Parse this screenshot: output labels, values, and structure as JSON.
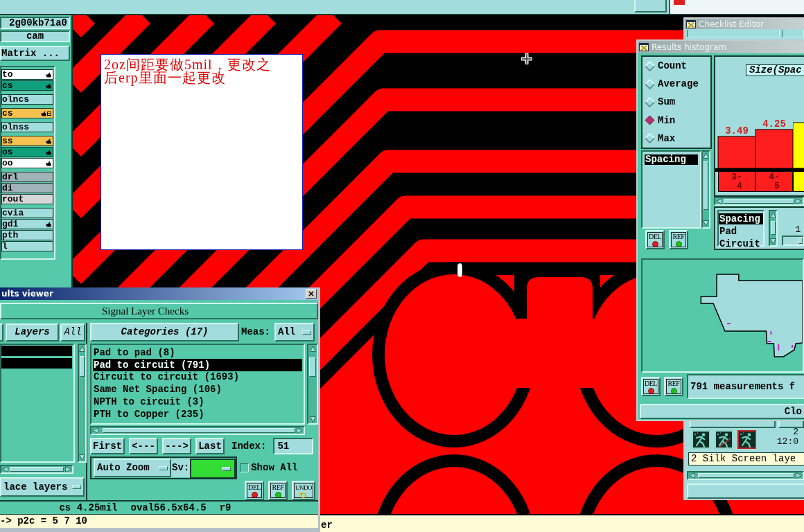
{
  "job": {
    "name": "2g00kb71a0",
    "step": "cam",
    "matrix_button": "Matrix ..."
  },
  "layer_groups": [
    {
      "layers": [
        {
          "name": "to",
          "color": "#ffffff",
          "affected": true,
          "work": false
        },
        {
          "name": "cs",
          "color": "#0f9f7d",
          "affected": true,
          "work": false
        }
      ]
    },
    {
      "layers": [
        {
          "name": "olncs",
          "color": "#a3dede",
          "affected": false,
          "work": false
        }
      ]
    },
    {
      "layers": [
        {
          "name": "cs",
          "color": "#f7c151",
          "affected": true,
          "work": true
        }
      ]
    },
    {
      "layers": [
        {
          "name": "olnss",
          "color": "#a3dede",
          "affected": false,
          "work": false
        }
      ]
    },
    {
      "layers": [
        {
          "name": "ss",
          "color": "#f7c151",
          "affected": true,
          "work": false
        },
        {
          "name": "os",
          "color": "#0f9f7d",
          "affected": true,
          "work": false
        },
        {
          "name": "oo",
          "color": "#ffffff",
          "affected": true,
          "work": false
        }
      ]
    },
    {
      "layers": [
        {
          "name": "drl",
          "color": "#9fb3b8",
          "affected": false,
          "work": false
        },
        {
          "name": "di",
          "color": "#9fb3b8",
          "affected": false,
          "work": false
        },
        {
          "name": "rout",
          "color": "#d6d6d6",
          "affected": false,
          "work": false
        }
      ]
    },
    {
      "layers": [
        {
          "name": "cvia",
          "color": "#a3dede",
          "affected": false,
          "work": false
        },
        {
          "name": "gd1",
          "color": "#a3dede",
          "affected": true,
          "work": false
        },
        {
          "name": "pth",
          "color": "#a3dede",
          "affected": false,
          "work": false
        },
        {
          "name": "l",
          "color": "#a3dede",
          "affected": false,
          "work": false
        }
      ]
    }
  ],
  "canvas": {
    "note": "2oz间距要做5mil，更改之后erp里面一起更改"
  },
  "results_viewer": {
    "title": "ults viewer",
    "header": "Signal Layer Checks",
    "layers_button": "Layers",
    "all_button": "All",
    "layer_rows": [
      {
        "selected": true
      },
      {
        "selected": true
      }
    ],
    "layer_scope": "lace layers",
    "categories_button": "Categories (17)",
    "meas_label": "Meas:",
    "meas_value": "All",
    "categories": [
      {
        "label": "Pad to pad (8)",
        "selected": false
      },
      {
        "label": "Pad to circuit (791)",
        "selected": true
      },
      {
        "label": "Circuit to circuit (1693)",
        "selected": false
      },
      {
        "label": "Same Net Spacing (106)",
        "selected": false
      },
      {
        "label": "NPTH to circuit (3)",
        "selected": false
      },
      {
        "label": "PTH to Copper (235)",
        "selected": false
      }
    ],
    "nav_buttons": [
      "First",
      "<---",
      "--->",
      "Last"
    ],
    "index_label": "Index:",
    "index_value": "51",
    "zoom_mode": "Auto Zoom",
    "sv_label": "Sv:",
    "show_all": {
      "label": "Show All",
      "checked": false
    },
    "tool_buttons": [
      {
        "kind": "delete",
        "label": "DEL"
      },
      {
        "kind": "refresh",
        "label": "REF"
      },
      {
        "kind": "undo",
        "label": "UNDO"
      }
    ],
    "measure_info": [
      "cs 4.25mil",
      "oval56.5x64.5",
      "r9"
    ],
    "command_line": "-> p2c = 5 7 10"
  },
  "histogram": {
    "title": "Results histogram",
    "modes": [
      {
        "label": "Count",
        "selected": false
      },
      {
        "label": "Average",
        "selected": false
      },
      {
        "label": "Sum",
        "selected": false
      },
      {
        "label": "Min",
        "selected": true
      },
      {
        "label": "Max",
        "selected": false
      }
    ],
    "types": [
      {
        "label": "Spacing",
        "selected": true
      }
    ],
    "list_buttons": [
      {
        "kind": "delete",
        "label": "DEL"
      },
      {
        "kind": "refresh",
        "label": "REF"
      }
    ],
    "chart_data": {
      "type": "bar",
      "title": "Size(Spac",
      "categories": [
        "3-4",
        "4-5"
      ],
      "series": [
        {
          "color": "#ff1e1e",
          "values": [
            3.49,
            4.25
          ]
        }
      ],
      "data_labels": true
    },
    "clipped_bar": {
      "color": "#ffff00"
    },
    "filters": [
      {
        "label": "Spacing",
        "selected": true
      },
      {
        "label": "Pad",
        "selected": false
      },
      {
        "label": "Circuit",
        "selected": false
      }
    ],
    "range_value": "1",
    "overview_buttons": [
      {
        "kind": "delete",
        "label": "DEL"
      },
      {
        "kind": "refresh",
        "label": "REF"
      }
    ],
    "summary": "791 measurements f",
    "close_button": "Clo"
  },
  "checklist_editor": {
    "title": "Checklist Editor",
    "time_lines": [
      "2",
      "12:0"
    ],
    "message": "2 Silk Screen laye"
  },
  "status_bar": {
    "text": "er"
  }
}
